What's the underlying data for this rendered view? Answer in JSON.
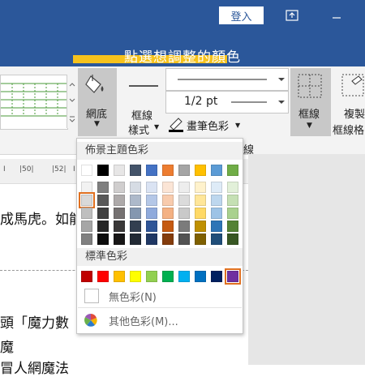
{
  "titlebar": {
    "login_label": "登入",
    "caption": "點選想調整的顏色"
  },
  "ribbon": {
    "shading_label": "網底",
    "border_styles_label_1": "框線",
    "border_styles_label_2": "樣式",
    "line_weight": "1/2 pt",
    "pen_color_label": "畫筆色彩",
    "borders_label": "框線",
    "painter_label_1": "複製",
    "painter_label_2": "框線格",
    "group_label_partial": "線"
  },
  "ruler": {
    "ticks": [
      "I",
      "|50|",
      "|52|",
      "I"
    ]
  },
  "document": {
    "line1": "成馬虎。如能",
    "line2": "頭「魔力數",
    "line3": "魔",
    "line4": "冒人網魔法"
  },
  "color_menu": {
    "theme_header": "佈景主題色彩",
    "standard_header": "標準色彩",
    "no_color": "無色彩(N)",
    "more_colors": "其他色彩(M)...",
    "theme_colors": [
      [
        "#ffffff",
        "#000000",
        "#e7e6e6",
        "#44546a",
        "#4472c4",
        "#ed7d31",
        "#a5a5a5",
        "#ffc000",
        "#5b9bd5",
        "#70ad47"
      ],
      [
        "#f2f2f2",
        "#7f7f7f",
        "#d0cece",
        "#d6dce4",
        "#dae3f3",
        "#fbe5d6",
        "#ededed",
        "#fff2cc",
        "#deebf7",
        "#e2f0d9"
      ],
      [
        "#d9d9d9",
        "#595959",
        "#aeaaaa",
        "#adb9ca",
        "#b4c7e7",
        "#f8cbad",
        "#dbdbdb",
        "#ffe699",
        "#bdd7ee",
        "#c5e0b4"
      ],
      [
        "#bfbfbf",
        "#404040",
        "#757171",
        "#8497b0",
        "#8faadc",
        "#f4b183",
        "#c9c9c9",
        "#ffd966",
        "#9dc3e6",
        "#a9d18e"
      ],
      [
        "#a6a6a6",
        "#262626",
        "#3a3838",
        "#333f50",
        "#2f5597",
        "#c55a11",
        "#7b7b7b",
        "#bf9000",
        "#2e75b6",
        "#548235"
      ],
      [
        "#808080",
        "#0d0d0d",
        "#171616",
        "#222a35",
        "#203864",
        "#843c0c",
        "#525252",
        "#7f6000",
        "#1f4e79",
        "#385723"
      ]
    ],
    "standard_colors": [
      "#c00000",
      "#ff0000",
      "#ffc000",
      "#ffff00",
      "#92d050",
      "#00b050",
      "#00b0f0",
      "#0070c0",
      "#002060",
      "#7030a0"
    ]
  }
}
